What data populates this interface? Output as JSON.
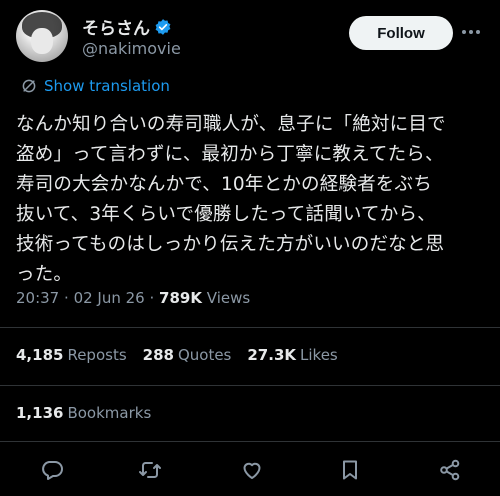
{
  "author": {
    "display_name": "そらさん",
    "handle": "@nakimovie",
    "verified": true
  },
  "follow_button_label": "Follow",
  "translation_label": "Show translation",
  "tweet_text": "なんか知り合いの寿司職人が、息子に「絶対に目で\n盗め」って言わずに、最初から丁寧に教えてたら、\n寿司の大会かなんかで、10年とかの経験者をぶち\n抜いて、3年くらいで優勝したって話聞いてから、\n技術ってものはしっかり伝えた方がいいのだなと思\nった。",
  "meta": {
    "time": "20:37",
    "date": "02 Jun 26",
    "views_count": "789K",
    "views_label": "Views"
  },
  "stats": {
    "reposts_count": "4,185",
    "reposts_label": "Reposts",
    "quotes_count": "288",
    "quotes_label": "Quotes",
    "likes_count": "27.3K",
    "likes_label": "Likes"
  },
  "bookmarks": {
    "count": "1,136",
    "label": "Bookmarks"
  },
  "colors": {
    "background": "#000000",
    "text": "#e7e9ea",
    "secondary": "#8b98a5",
    "accent": "#1d9bf0",
    "divider": "#2f3336"
  },
  "icons": [
    "verified-badge-icon",
    "more-icon",
    "translate-icon",
    "reply-icon",
    "repost-icon",
    "like-icon",
    "bookmark-icon",
    "share-icon"
  ]
}
